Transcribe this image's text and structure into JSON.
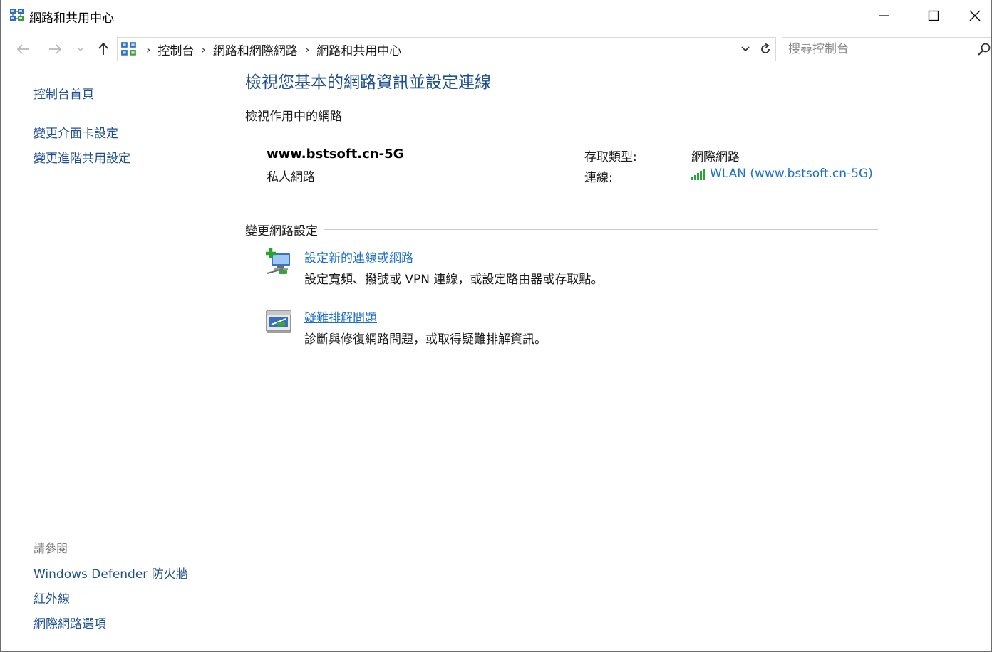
{
  "window": {
    "title": "網路和共用中心"
  },
  "address_bar": {
    "breadcrumbs": [
      "控制台",
      "網路和網際網路",
      "網路和共用中心"
    ],
    "search_placeholder": "搜尋控制台"
  },
  "left_pane": {
    "links": [
      "控制台首頁",
      "變更介面卡設定",
      "變更進階共用設定"
    ],
    "see_also_label": "請參閱",
    "see_also_links": [
      "Windows Defender 防火牆",
      "紅外線",
      "網際網路選項"
    ]
  },
  "main": {
    "title": "檢視您基本的網路資訊並設定連線",
    "active_networks_heading": "檢視作用中的網路",
    "network": {
      "name": "www.bstsoft.cn-5G",
      "category": "私人網路",
      "access_type_label": "存取類型:",
      "access_type_value": "網際網路",
      "connections_label": "連線:",
      "connection_link": "WLAN (www.bstsoft.cn-5G)",
      "signal_bars": 5
    },
    "change_settings_heading": "變更網路設定",
    "tasks": [
      {
        "title": "設定新的連線或網路",
        "description": "設定寬頻、撥號或 VPN 連線，或設定路由器或存取點。",
        "icon": "new-connection-icon"
      },
      {
        "title": "疑難排解問題",
        "description": "診斷與修復網路問題，或取得疑難排解資訊。",
        "icon": "troubleshoot-icon"
      }
    ]
  },
  "colors": {
    "link": "#1d6fc9",
    "nav_link": "#1d4f91",
    "signal": "#2ba336"
  }
}
